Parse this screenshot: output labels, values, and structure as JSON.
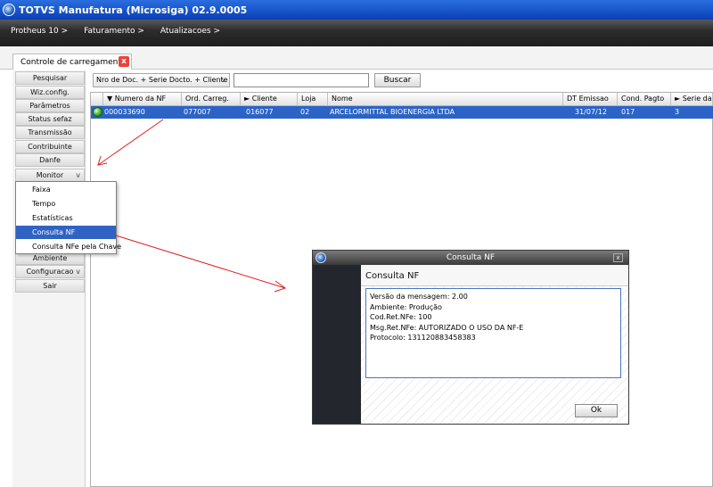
{
  "window": {
    "title": "TOTVS Manufatura (Microsiga) 02.9.0005"
  },
  "breadcrumb": [
    "Protheus 10 >",
    "Faturamento >",
    "Atualizacoes >"
  ],
  "tab": {
    "label": "Controle de carregamento",
    "close": "x"
  },
  "sidebar": {
    "items": [
      "Pesquisar",
      "Wiz.config.",
      "Parâmetros",
      "Status sefaz",
      "Transmissão",
      "Contribuinte",
      "Danfe",
      "Monitor",
      "Ambiente",
      "Configuracao",
      "Sair"
    ],
    "expandable": {
      "monitor": "v",
      "configuracao": "v"
    }
  },
  "monitor_menu": {
    "items": [
      "Faixa",
      "Tempo",
      "Estatísticas",
      "Consulta NF",
      "Consulta NFe pela Chave"
    ],
    "selected": "Consulta NF"
  },
  "search": {
    "index": "Nro de Doc. + Serie Docto. + Cliente + L",
    "dropdown": "v",
    "value": "",
    "button": "Buscar"
  },
  "grid": {
    "columns": [
      "Numero da NF",
      "Ord. Carreg.",
      "Cliente",
      "Loja",
      "Nome",
      "DT Emissao",
      "Cond. Pagto",
      "Serie da"
    ],
    "rows": [
      {
        "status": "green",
        "numero_nf": "000033690",
        "ord_carreg": "077007",
        "cliente": "016077",
        "loja": "02",
        "nome": "ARCELORMITTAL BIOENERGIA LTDA",
        "dt_emissao": "31/07/12",
        "cond_pagto": "017",
        "serie": "3"
      }
    ]
  },
  "dialog": {
    "title": "Consulta NF",
    "heading": "Consulta NF",
    "lines": [
      "Versão da mensagem: 2.00",
      "Ambiente: Produção",
      "Cod.Ret.NFe: 100",
      "Msg.Ret.NFe: AUTORIZADO O USO DA NF-E",
      "Protocolo: 131120883458383"
    ],
    "ok_button": "Ok",
    "close": "x"
  },
  "colors": {
    "selection": "#2b63c7",
    "title_bar": "#0a3fb5",
    "annotation_arrow": "#e02020"
  }
}
